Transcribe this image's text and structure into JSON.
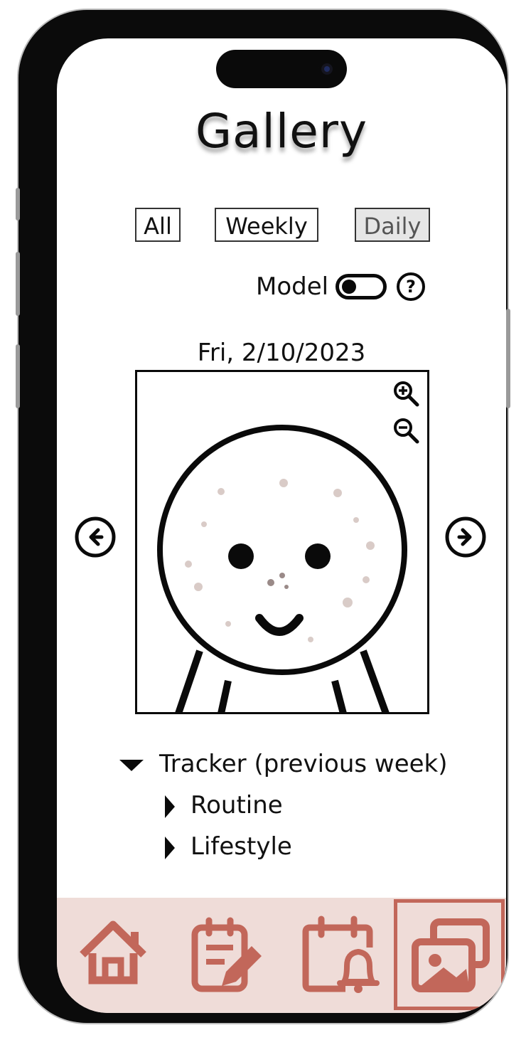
{
  "page": {
    "title": "Gallery"
  },
  "filters": [
    {
      "label": "All",
      "active": false
    },
    {
      "label": "Weekly",
      "active": false
    },
    {
      "label": "Daily",
      "active": true
    }
  ],
  "model_toggle": {
    "label": "Model",
    "on": false,
    "help_icon": "question-icon"
  },
  "viewer": {
    "date": "Fri, 2/10/2023",
    "zoom_in_icon": "zoom-in-icon",
    "zoom_out_icon": "zoom-out-icon",
    "prev_icon": "arrow-left-icon",
    "next_icon": "arrow-right-icon"
  },
  "tracker": {
    "label": "Tracker (previous week)",
    "expanded": true,
    "children": [
      {
        "label": "Routine",
        "expanded": false
      },
      {
        "label": "Lifestyle",
        "expanded": false
      }
    ]
  },
  "tab_bar": {
    "items": [
      {
        "icon": "home-icon",
        "active": false
      },
      {
        "icon": "journal-edit-icon",
        "active": false
      },
      {
        "icon": "calendar-reminder-icon",
        "active": false
      },
      {
        "icon": "gallery-icon",
        "active": true
      }
    ]
  },
  "colors": {
    "accent": "#c2675a",
    "tab_bar_bg": "#efdcd8",
    "active_filter_bg": "#e6e6e6"
  }
}
